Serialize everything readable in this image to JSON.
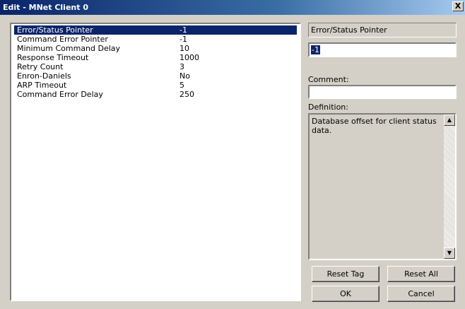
{
  "window": {
    "title": "Edit - MNet Client 0",
    "close_symbol": "X"
  },
  "params": [
    {
      "key": "Error/Status Pointer",
      "value": "-1"
    },
    {
      "key": "Command Error Pointer",
      "value": "-1"
    },
    {
      "key": "Minimum Command Delay",
      "value": "10"
    },
    {
      "key": "Response Timeout",
      "value": "1000"
    },
    {
      "key": "Retry Count",
      "value": "3"
    },
    {
      "key": "Enron-Daniels",
      "value": "No"
    },
    {
      "key": "ARP Timeout",
      "value": "5"
    },
    {
      "key": "Command Error Delay",
      "value": "250"
    }
  ],
  "editor": {
    "selected_name": "Error/Status Pointer",
    "value": "-1",
    "comment_label": "Comment:",
    "comment_value": "",
    "definition_label": "Definition:",
    "definition_text": "Database offset for client status data."
  },
  "buttons": {
    "reset_tag": "Reset Tag",
    "reset_all": "Reset All",
    "ok": "OK",
    "cancel": "Cancel"
  }
}
